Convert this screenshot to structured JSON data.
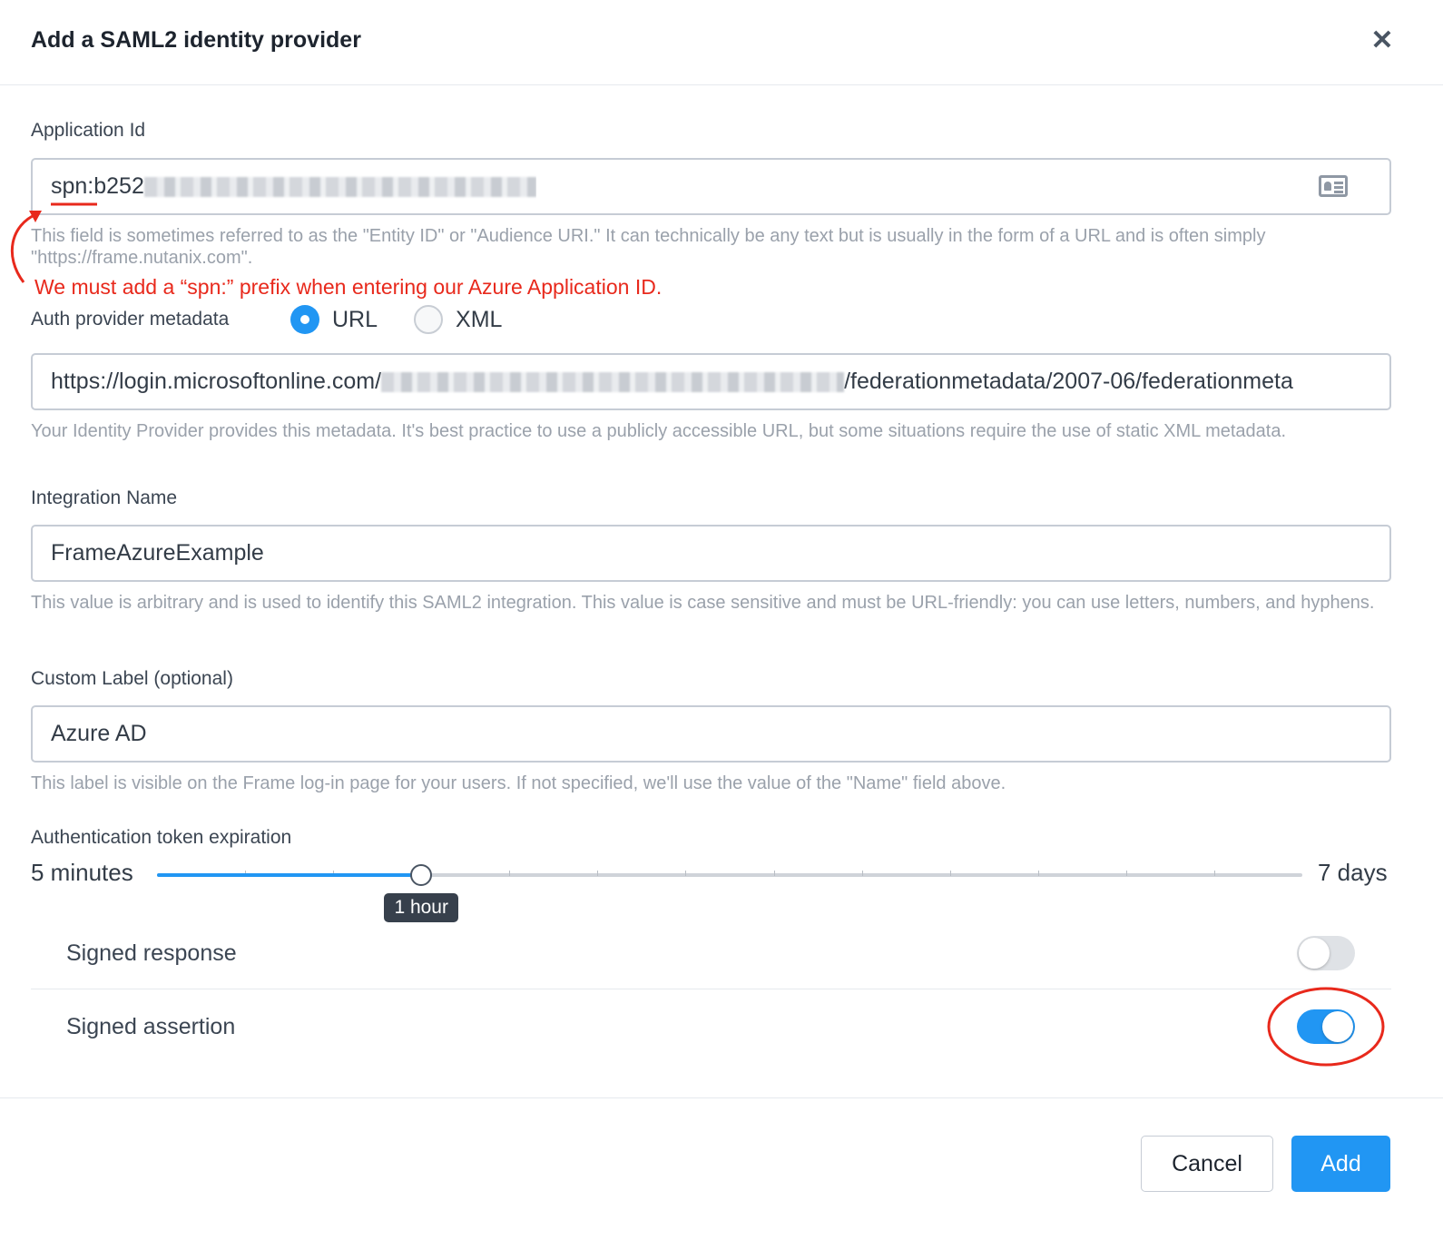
{
  "dialog": {
    "title": "Add a SAML2 identity provider",
    "close_symbol": "✕"
  },
  "application_id": {
    "label": "Application Id",
    "value_visible": "spn:b252",
    "value_obscured": true,
    "icon": "contact-card-icon",
    "help": "This field is sometimes referred to as the \"Entity ID\" or \"Audience URI.\" It can technically be any text but is usually in the form of a URL and is often simply \"https://frame.nutanix.com\"."
  },
  "annotation": {
    "note": "We must add a “spn:” prefix when entering our Azure Application ID.",
    "color": "#e8291c"
  },
  "metadata": {
    "label": "Auth provider metadata",
    "options": [
      "URL",
      "XML"
    ],
    "selected": "URL",
    "url_prefix": "https://login.microsoftonline.com/",
    "url_suffix": "/federationmetadata/2007-06/federationmeta",
    "help": "Your Identity Provider provides this metadata. It's best practice to use a publicly accessible URL, but some situations require the use of static XML metadata."
  },
  "integration": {
    "label": "Integration Name",
    "value": "FrameAzureExample",
    "help": "This value is arbitrary and is used to identify this SAML2 integration. This value is case sensitive and must be URL-friendly: you can use letters, numbers, and hyphens."
  },
  "custom_label": {
    "label": "Custom Label (optional)",
    "value": "Azure AD",
    "help": "This label is visible on the Frame log-in page for your users. If not specified, we'll use the value of the \"Name\" field above."
  },
  "token_expiration": {
    "label": "Authentication token expiration",
    "min_label": "5 minutes",
    "max_label": "7 days",
    "current": "1 hour",
    "step_count": 13,
    "current_step": 3
  },
  "toggles": [
    {
      "label": "Signed response",
      "on": false
    },
    {
      "label": "Signed assertion",
      "on": true
    }
  ],
  "buttons": {
    "cancel": "Cancel",
    "add": "Add"
  },
  "colors": {
    "accent": "#2196f3",
    "annotation": "#e8291c",
    "tooltip_bg": "#37404c"
  }
}
